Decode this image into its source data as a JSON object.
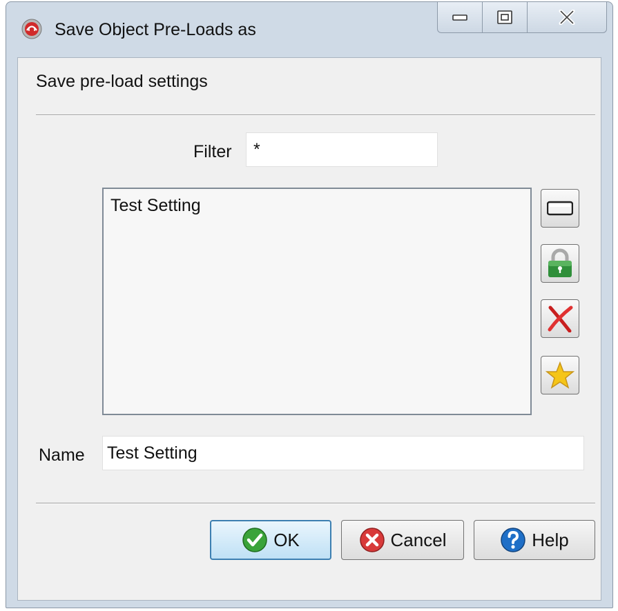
{
  "window": {
    "title": "Save Object Pre-Loads as"
  },
  "heading": "Save pre-load settings",
  "filter": {
    "label": "Filter",
    "value": "*"
  },
  "list": {
    "items": [
      "Test Setting"
    ]
  },
  "side_buttons": [
    {
      "icon": "rename-icon"
    },
    {
      "icon": "lock-icon"
    },
    {
      "icon": "delete-icon"
    },
    {
      "icon": "favorite-star-icon"
    }
  ],
  "name": {
    "label": "Name",
    "value": "Test Setting"
  },
  "buttons": {
    "ok": "OK",
    "cancel": "Cancel",
    "help": "Help"
  },
  "colors": {
    "ok_icon": "#3aa33a",
    "cancel_icon": "#d83a3a",
    "help_icon": "#1f6fc7",
    "lock_body": "#2f8f3a",
    "star": "#f5c518"
  }
}
